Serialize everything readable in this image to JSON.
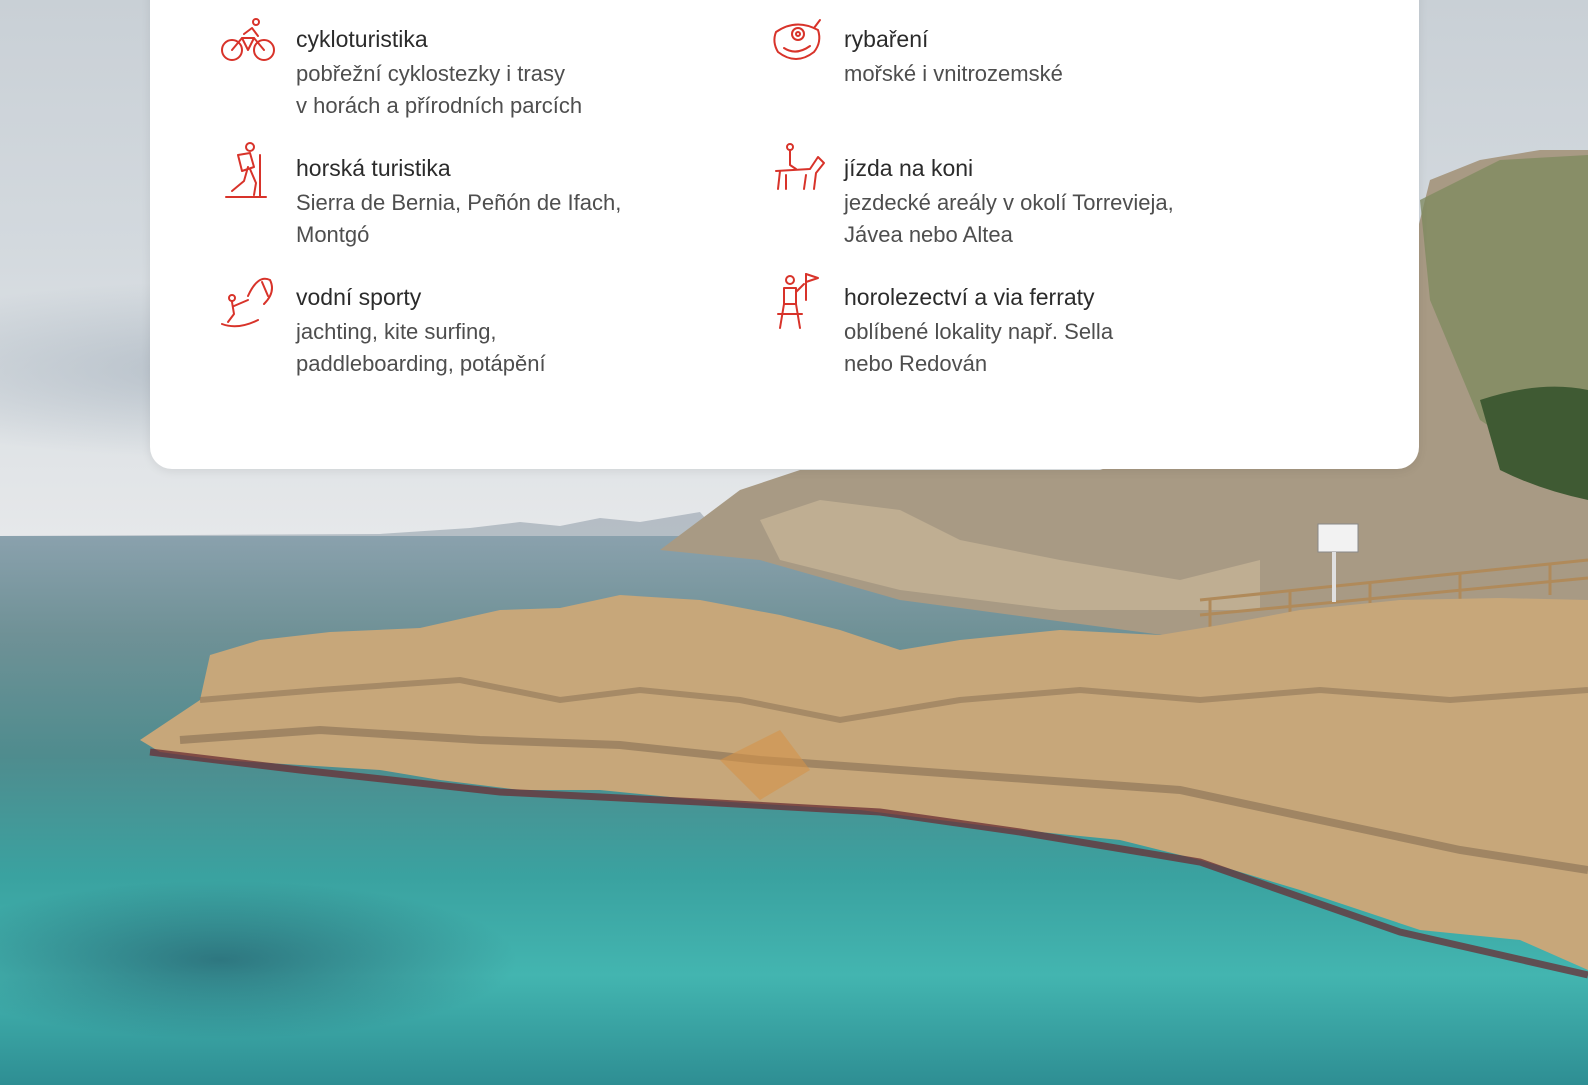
{
  "activities": [
    {
      "icon": "cyclist-icon",
      "title": "cykloturistika",
      "desc": "pobřežní cyklostezky i trasy\nv horách a přírodních parcích"
    },
    {
      "icon": "fish-icon",
      "title": "rybaření",
      "desc": "mořské i vnitrozemské"
    },
    {
      "icon": "hiker-icon",
      "title": "horská turistika",
      "desc": "Sierra de Bernia, Peñón de Ifach,\nMontgó"
    },
    {
      "icon": "horse-rider-icon",
      "title": "jízda na koni",
      "desc": "jezdecké areály v okolí Torrevieja,\nJávea nebo Altea"
    },
    {
      "icon": "kitesurf-icon",
      "title": "vodní sporty",
      "desc": "jachting, kite surfing,\npaddleboarding, potápění"
    },
    {
      "icon": "climber-icon",
      "title": "horolezectví a via ferraty",
      "desc": "oblíbené lokality např. Sella\nnebo Redován"
    }
  ],
  "colors": {
    "accent": "#d8332a",
    "card_bg": "#ffffff",
    "title_text": "#2b2b2b",
    "desc_text": "#4e4e4e"
  }
}
